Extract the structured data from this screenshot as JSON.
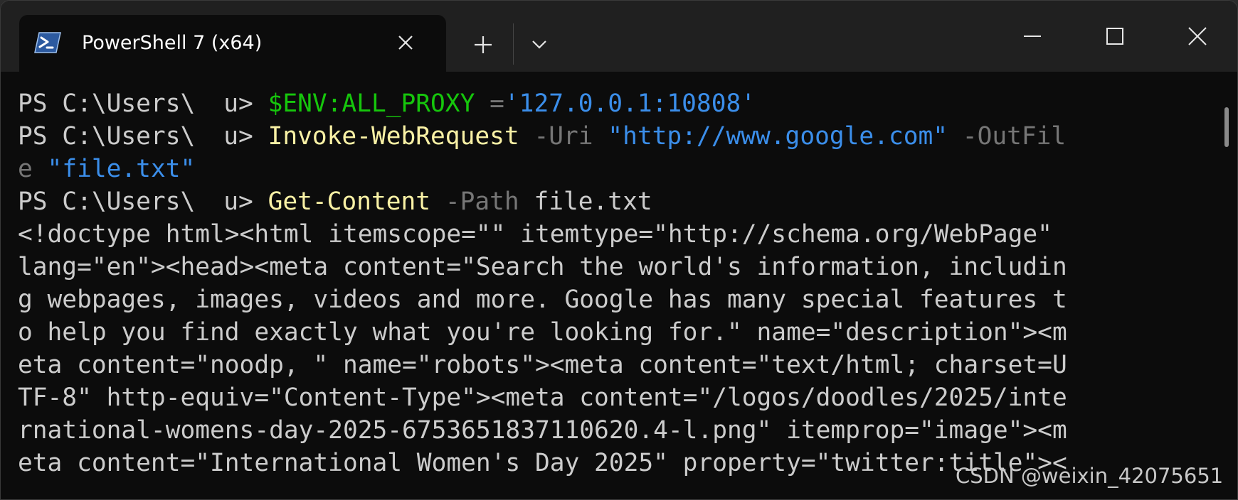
{
  "window": {
    "tab_title": "PowerShell 7 (x64)",
    "tab_icon": "powershell-icon",
    "buttons": {
      "close_tab": "close-icon",
      "new_tab": "plus-icon",
      "dropdown": "chevron-down-icon",
      "minimize": "minimize-icon",
      "maximize": "maximize-icon",
      "close_window": "close-icon"
    }
  },
  "terminal": {
    "lines": [
      {
        "prompt": "PS C:\\Users\\",
        "prompt_tail": "u> ",
        "var": "$ENV:ALL_PROXY",
        "op": " =",
        "str": "'127.0.0.1:10808'"
      },
      {
        "prompt": "PS C:\\Users\\",
        "prompt_tail": "u> ",
        "cmd": "Invoke-WebRequest",
        "param1": " -Uri ",
        "str1": "\"http://www.google.com\"",
        "param2": " -OutFil"
      },
      {
        "param_cont": "e ",
        "str": "\"file.txt\""
      },
      {
        "prompt": "PS C:\\Users\\",
        "prompt_tail": "u> ",
        "cmd": "Get-Content",
        "param": " -Path ",
        "arg": "file.txt"
      }
    ],
    "output": [
      "<!doctype html><html itemscope=\"\" itemtype=\"http://schema.org/WebPage\"",
      "lang=\"en\"><head><meta content=\"Search the world's information, includin",
      "g webpages, images, videos and more. Google has many special features t",
      "o help you find exactly what you're looking for.\" name=\"description\"><m",
      "eta content=\"noodp, \" name=\"robots\"><meta content=\"text/html; charset=U",
      "TF-8\" http-equiv=\"Content-Type\"><meta content=\"/logos/doodles/2025/inte",
      "rnational-womens-day-2025-6753651837110620.4-l.png\" itemprop=\"image\"><m",
      "eta content=\"International Women's Day 2025\" property=\"twitter:title\"><"
    ]
  },
  "watermark": "CSDN @weixin_42075651",
  "colors": {
    "background": "#0c0c0c",
    "titlebar": "#202020",
    "variable": "#16c60c",
    "string": "#3b8eea",
    "command": "#f9f1a5",
    "parameter": "#767676",
    "text": "#cccccc"
  }
}
